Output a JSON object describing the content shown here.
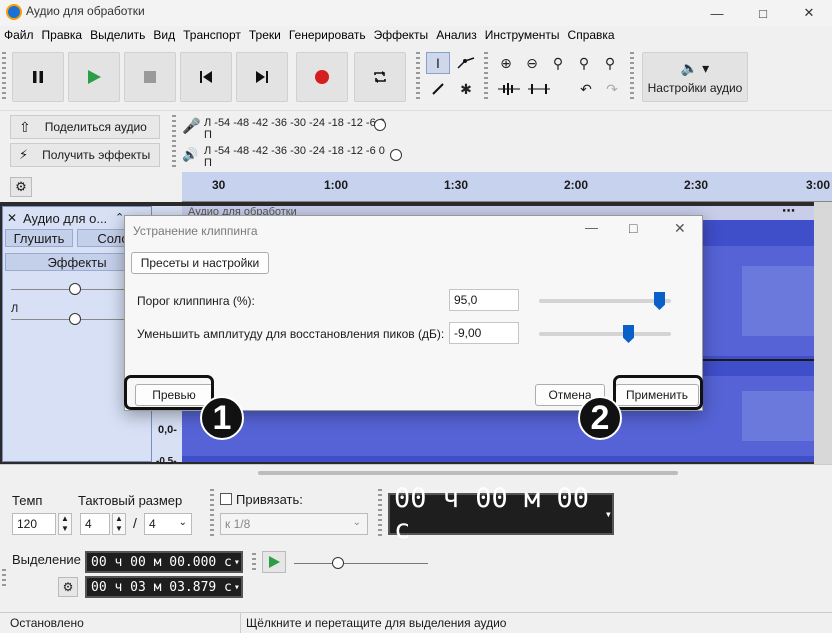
{
  "window": {
    "title": "Аудио для обработки"
  },
  "menu": [
    "Файл",
    "Правка",
    "Выделить",
    "Вид",
    "Транспорт",
    "Треки",
    "Генерировать",
    "Эффекты",
    "Анализ",
    "Инструменты",
    "Справка"
  ],
  "toolbar": {
    "audio_settings_label": "Настройки аудио"
  },
  "share": {
    "share_label": "Поделиться аудио",
    "effects_label": "Получить эффекты"
  },
  "meters": {
    "record_scale": "Л  -54 -48 -42 -36 -30 -24 -18  -12  -6  0",
    "record_scale2": "П",
    "play_scale": "Л  -54 -48 -42 -36 -30 -24 -18  -12  -6  0",
    "play_scale2": "П"
  },
  "ruler": {
    "ticks": [
      "30",
      "1:00",
      "1:30",
      "2:00",
      "2:30",
      "3:00"
    ]
  },
  "track": {
    "name": "Аудио для о...",
    "mute_label": "Глушить",
    "solo_label": "Соло",
    "effects_label": "Эффекты",
    "wave_title": "Аудио для обработки",
    "channel_l": "Л",
    "scale_top": "0,0-",
    "scale_mid": "0,0-",
    "scale_bot": "-0,5-"
  },
  "dialog": {
    "title": "Устранение клиппинга",
    "presets_label": "Пресеты и настройки",
    "threshold_label": "Порог клиппинга (%):",
    "threshold_value": "95,0",
    "threshold_level": 0.95,
    "reduce_label": "Уменьшить амплитуду для восстановления пиков (дБ):",
    "reduce_value": "-9,00",
    "preview_label": "Превью",
    "cancel_label": "Отмена",
    "apply_label": "Применить"
  },
  "badges": {
    "one": "1",
    "two": "2"
  },
  "bottom": {
    "tempo_label": "Темп",
    "tempo_value": "120",
    "timesig_label": "Тактовый размер",
    "timesig_num": "4",
    "timesig_sep": "/",
    "timesig_den": "4",
    "snap_label": "Привязать:",
    "snap_value": "к 1/8",
    "big_time": "00 ч 00 м 00 с",
    "selection_label": "Выделение",
    "sel_start": "00 ч 00 м 00.000 с",
    "sel_end": "00 ч 03 м 03.879 с"
  },
  "status": {
    "left": "Остановлено",
    "right": "Щёлкните и перетащите для выделения аудио"
  }
}
